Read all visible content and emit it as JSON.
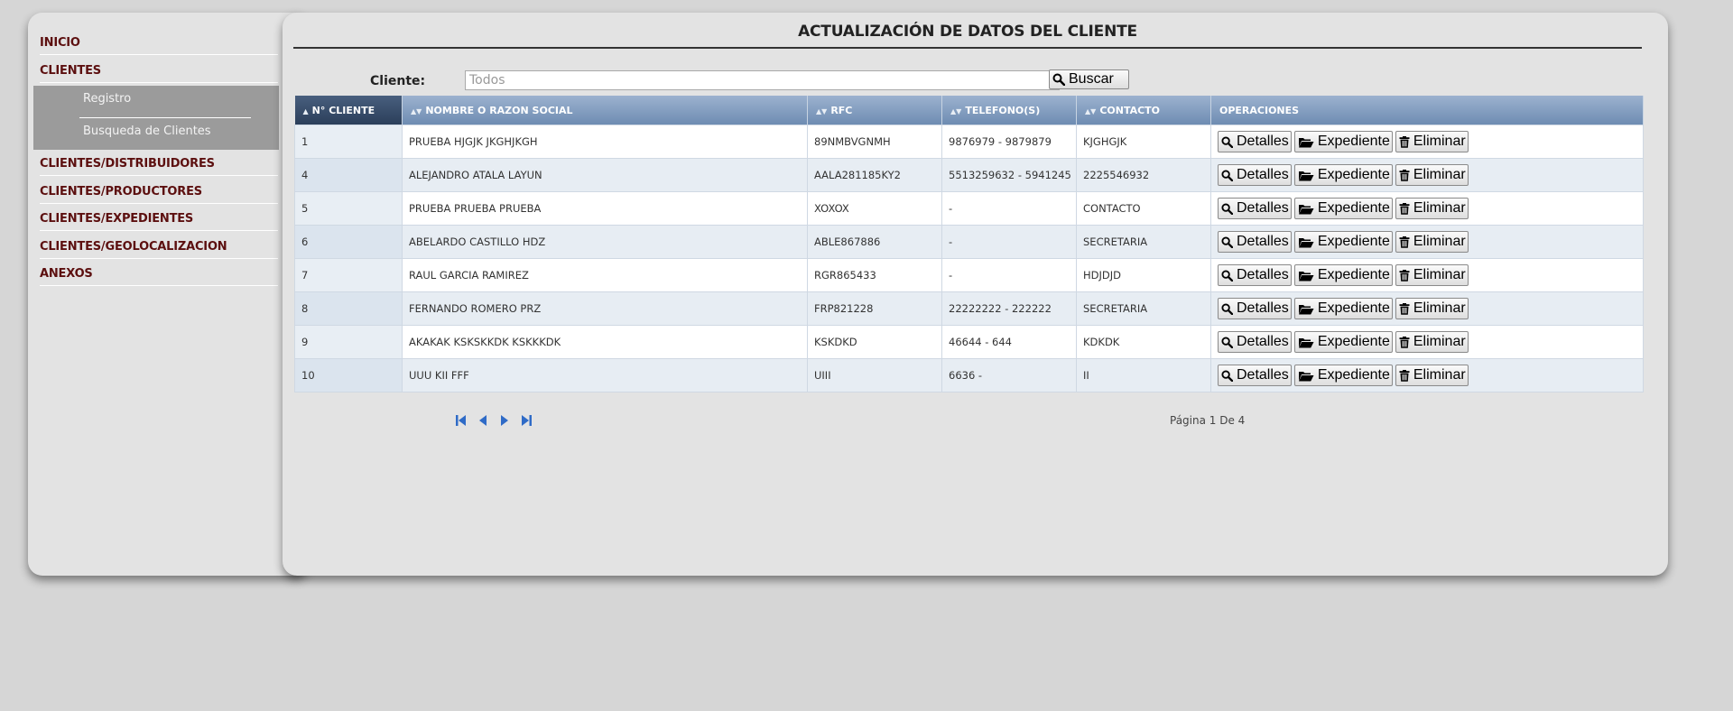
{
  "sidebar": {
    "items": [
      {
        "label": "INICIO"
      },
      {
        "label": "CLIENTES"
      },
      {
        "label": "CLIENTES/DISTRIBUIDORES"
      },
      {
        "label": "CLIENTES/PRODUCTORES"
      },
      {
        "label": "CLIENTES/EXPEDIENTES"
      },
      {
        "label": "CLIENTES/GEOLOCALIZACION"
      },
      {
        "label": "ANEXOS"
      }
    ],
    "submenu": [
      {
        "label": "Registro"
      },
      {
        "label": "Busqueda de Clientes"
      }
    ]
  },
  "main": {
    "title": "ACTUALIZACIÓN DE DATOS DEL CLIENTE",
    "search": {
      "label": "Cliente:",
      "placeholder": "Todos",
      "value": "",
      "button_label": "Buscar"
    },
    "table": {
      "columns": [
        "N° CLIENTE",
        "NOMBRE O RAZON SOCIAL",
        "RFC",
        "TELEFONO(S)",
        "CONTACTO",
        "OPERACIONES"
      ],
      "rows": [
        [
          "1",
          "PRUEBA HJGJK JKGHJKGH",
          "89NMBVGNMH",
          "9876979 - 9879879",
          "KJGHGJK"
        ],
        [
          "4",
          "ALEJANDRO ATALA LAYUN",
          "AALA281185KY2",
          "5513259632 - 5941245",
          "2225546932"
        ],
        [
          "5",
          "PRUEBA PRUEBA PRUEBA",
          "XOXOX",
          "-",
          "CONTACTO"
        ],
        [
          "6",
          "ABELARDO CASTILLO HDZ",
          "ABLE867886",
          "-",
          "SECRETARIA"
        ],
        [
          "7",
          "RAUL GARCIA RAMIREZ",
          "RGR865433",
          "-",
          "HDJDJD"
        ],
        [
          "8",
          "FERNANDO ROMERO PRZ",
          "FRP821228",
          "22222222 - 222222",
          "SECRETARIA"
        ],
        [
          "9",
          "AKAKAK KSKSKKDK KSKKKDK",
          "KSKDKD",
          "46644 - 644",
          "KDKDK"
        ],
        [
          "10",
          "UUU KII FFF",
          "UIII",
          "6636 -",
          "II"
        ]
      ],
      "actions": {
        "details": "Detalles",
        "file": "Expediente",
        "delete": "Eliminar"
      }
    },
    "pagination": {
      "text": "Página 1 De 4"
    }
  },
  "colors": {
    "menu_text": "#5c0f0f",
    "header_blue": "#7b97bb",
    "header_sorted": "#2f4461"
  },
  "icons": [
    "search-icon",
    "folder-open-icon",
    "trash-icon",
    "first-page-icon",
    "prev-page-icon",
    "next-page-icon",
    "last-page-icon",
    "sort-icon"
  ]
}
